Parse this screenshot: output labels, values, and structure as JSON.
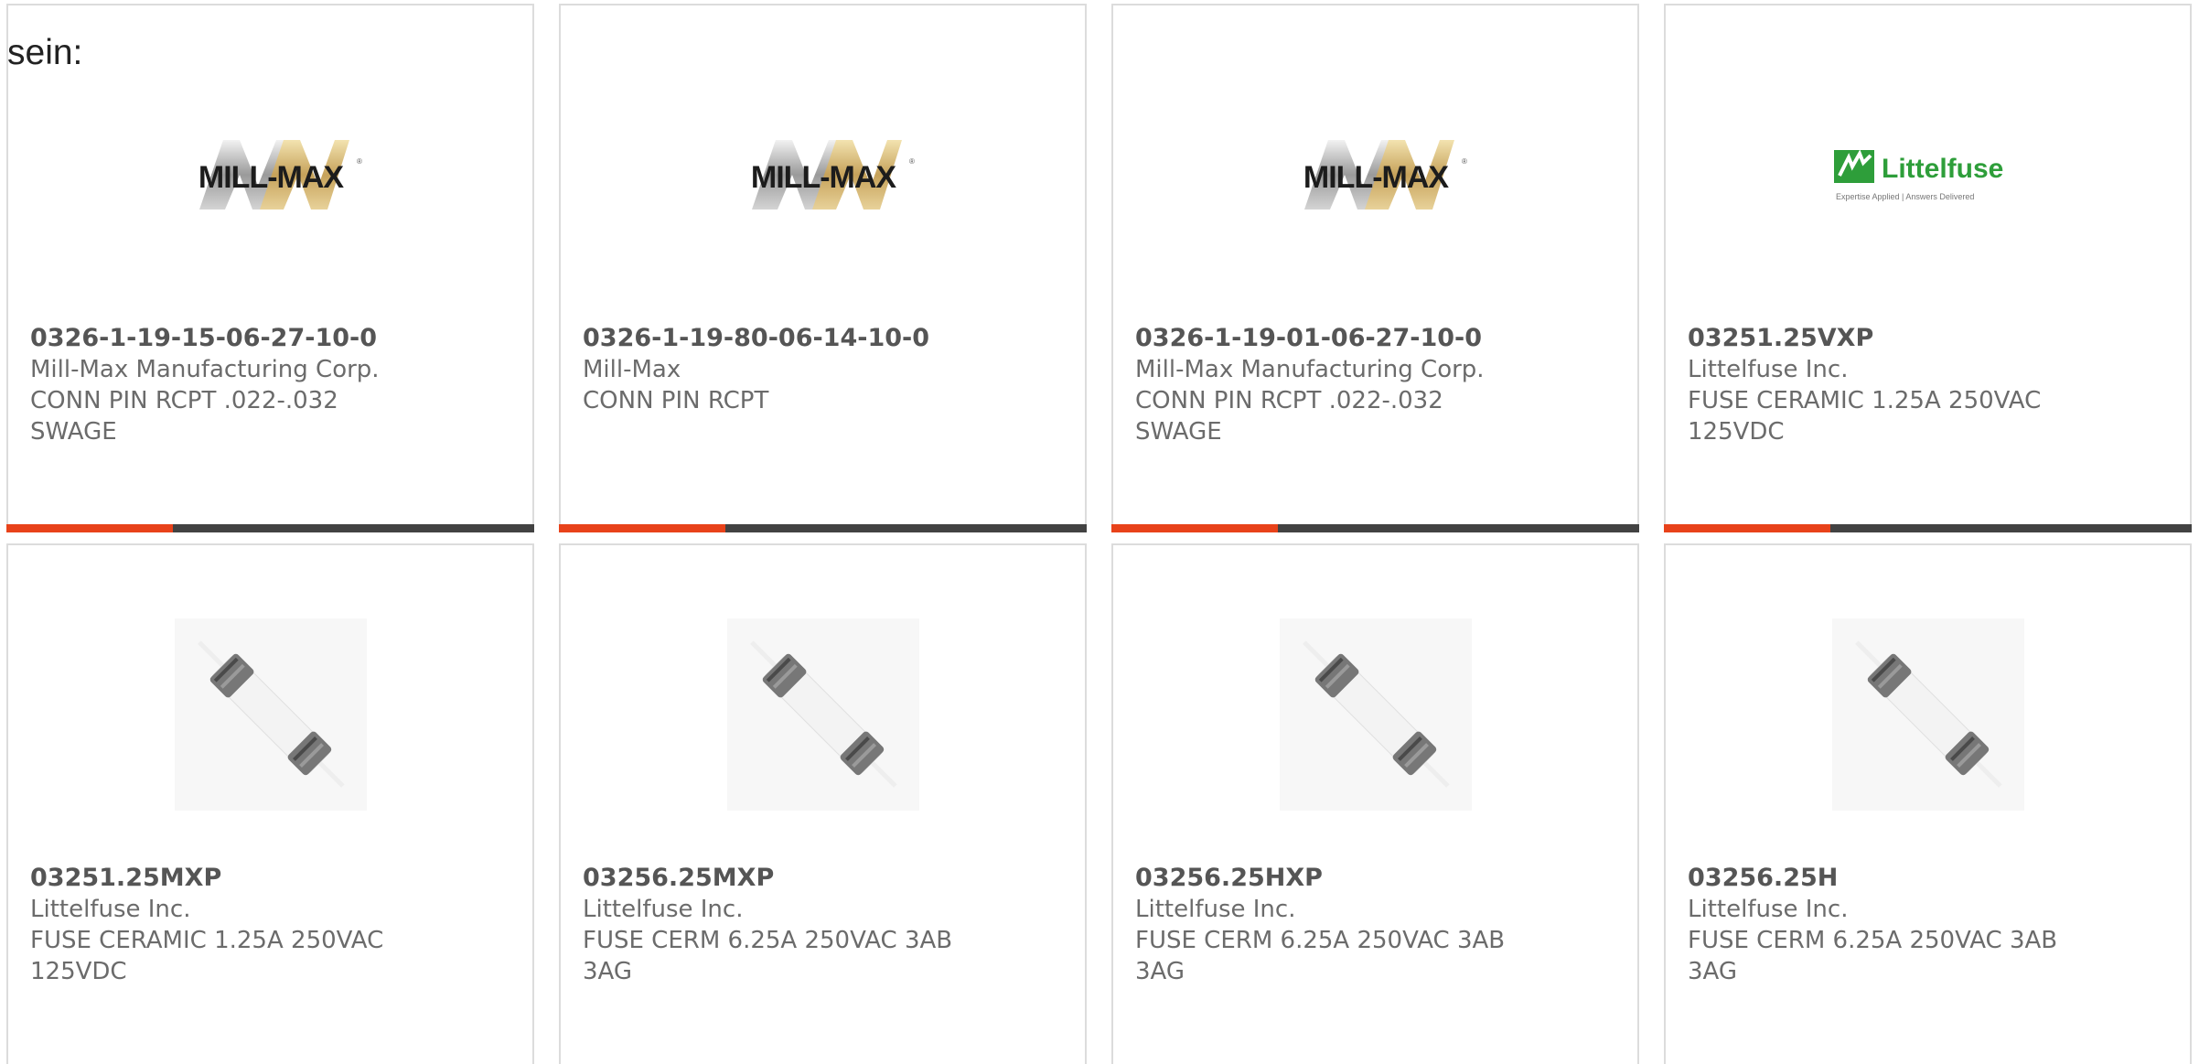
{
  "lead_text": "sein:",
  "colors": {
    "accent": "#e8421a",
    "bar": "#424242",
    "card_border": "#dcdcdc",
    "text": "#6b6b6b",
    "part_number": "#555555"
  },
  "cards": [
    {
      "part_number": "0326-1-19-15-06-27-10-0",
      "manufacturer": "Mill-Max Manufacturing Corp.",
      "description_lines": [
        "CONN PIN RCPT .022-.032",
        "SWAGE"
      ],
      "image": "mill-max-logo",
      "logo_text": "MILL-MAX"
    },
    {
      "part_number": "0326-1-19-80-06-14-10-0",
      "manufacturer": "Mill-Max",
      "description_lines": [
        "CONN PIN RCPT",
        ""
      ],
      "image": "mill-max-logo",
      "logo_text": "MILL-MAX"
    },
    {
      "part_number": "0326-1-19-01-06-27-10-0",
      "manufacturer": "Mill-Max Manufacturing Corp.",
      "description_lines": [
        "CONN PIN RCPT .022-.032",
        "SWAGE"
      ],
      "image": "mill-max-logo",
      "logo_text": "MILL-MAX"
    },
    {
      "part_number": "03251.25VXP",
      "manufacturer": "Littelfuse Inc.",
      "description_lines": [
        "FUSE CERAMIC 1.25A 250VAC",
        "125VDC"
      ],
      "image": "littelfuse-logo",
      "logo_text": "Littelfuse",
      "logo_tagline": "Expertise Applied | Answers Delivered"
    },
    {
      "part_number": "03251.25MXP",
      "manufacturer": "Littelfuse Inc.",
      "description_lines": [
        "FUSE CERAMIC 1.25A 250VAC",
        "125VDC"
      ],
      "image": "cartridge-fuse-photo"
    },
    {
      "part_number": "03256.25MXP",
      "manufacturer": "Littelfuse Inc.",
      "description_lines": [
        "FUSE CERM 6.25A 250VAC 3AB",
        "3AG"
      ],
      "image": "cartridge-fuse-photo"
    },
    {
      "part_number": "03256.25HXP",
      "manufacturer": "Littelfuse Inc.",
      "description_lines": [
        "FUSE CERM 6.25A 250VAC 3AB",
        "3AG"
      ],
      "image": "cartridge-fuse-photo"
    },
    {
      "part_number": "03256.25H",
      "manufacturer": "Littelfuse Inc.",
      "description_lines": [
        "FUSE CERM 6.25A 250VAC 3AB",
        "3AG"
      ],
      "image": "cartridge-fuse-photo"
    }
  ]
}
